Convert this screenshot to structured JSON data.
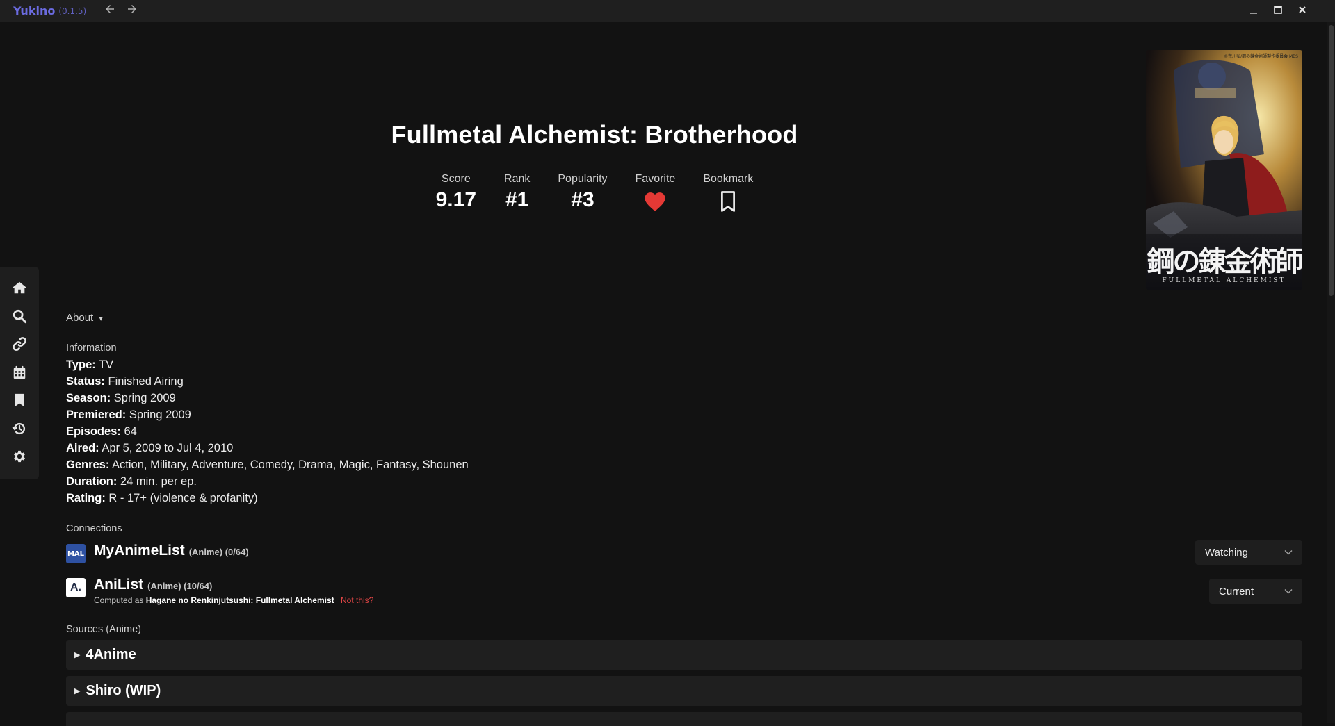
{
  "app": {
    "name": "Yukino",
    "version": "(0.1.5)"
  },
  "titlebar": {
    "back_icon": "arrow-left-icon",
    "forward_icon": "arrow-right-icon",
    "minimize": "_",
    "maximize": "□",
    "close": "✕"
  },
  "sidebar": {
    "items": [
      {
        "name": "home",
        "icon": "home-icon"
      },
      {
        "name": "search",
        "icon": "search-icon"
      },
      {
        "name": "connections",
        "icon": "link-icon"
      },
      {
        "name": "schedule",
        "icon": "calendar-icon"
      },
      {
        "name": "bookmarks",
        "icon": "bookmark-icon"
      },
      {
        "name": "history",
        "icon": "history-icon"
      },
      {
        "name": "settings",
        "icon": "gear-icon"
      }
    ]
  },
  "anime": {
    "title": "Fullmetal Alchemist: Brotherhood",
    "stats": {
      "score_label": "Score",
      "score": "9.17",
      "rank_label": "Rank",
      "rank": "#1",
      "popularity_label": "Popularity",
      "popularity": "#3",
      "favorite_label": "Favorite",
      "bookmark_label": "Bookmark"
    },
    "poster": {
      "kanji": "鋼の錬金術師",
      "subtitle": "FULLMETAL ALCHEMIST",
      "copyright": "©荒川弘/鋼の錬金術師製作委員会·MBS"
    }
  },
  "about": {
    "label": "About",
    "caret": "▾"
  },
  "information": {
    "heading": "Information",
    "rows": [
      {
        "key": "Type:",
        "value": "TV"
      },
      {
        "key": "Status:",
        "value": "Finished Airing"
      },
      {
        "key": "Season:",
        "value": "Spring 2009"
      },
      {
        "key": "Premiered:",
        "value": "Spring 2009"
      },
      {
        "key": "Episodes:",
        "value": "64"
      },
      {
        "key": "Aired:",
        "value": "Apr 5, 2009 to Jul 4, 2010"
      },
      {
        "key": "Genres:",
        "value": "Action, Military, Adventure, Comedy, Drama, Magic, Fantasy, Shounen"
      },
      {
        "key": "Duration:",
        "value": "24 min. per ep."
      },
      {
        "key": "Rating:",
        "value": "R - 17+ (violence & profanity)"
      }
    ]
  },
  "connections": {
    "heading": "Connections",
    "mal": {
      "logo": "MAL",
      "name": "MyAnimeList",
      "meta": "(Anime) (0/64)",
      "status": "Watching"
    },
    "anilist": {
      "logo": "A.",
      "name": "AniList",
      "meta": "(Anime) (10/64)",
      "computed_prefix": "Computed as",
      "computed_title": "Hagane no Renkinjutsushi: Fullmetal Alchemist",
      "not_this": "Not this?",
      "status": "Current"
    }
  },
  "sources": {
    "heading": "Sources (Anime)",
    "items": [
      {
        "name": "4Anime"
      },
      {
        "name": "Shiro (WIP)"
      }
    ]
  },
  "colors": {
    "accent": "#6b6be0",
    "heart": "#e53935",
    "danger": "#e24646",
    "mal_blue": "#2e51a2"
  }
}
